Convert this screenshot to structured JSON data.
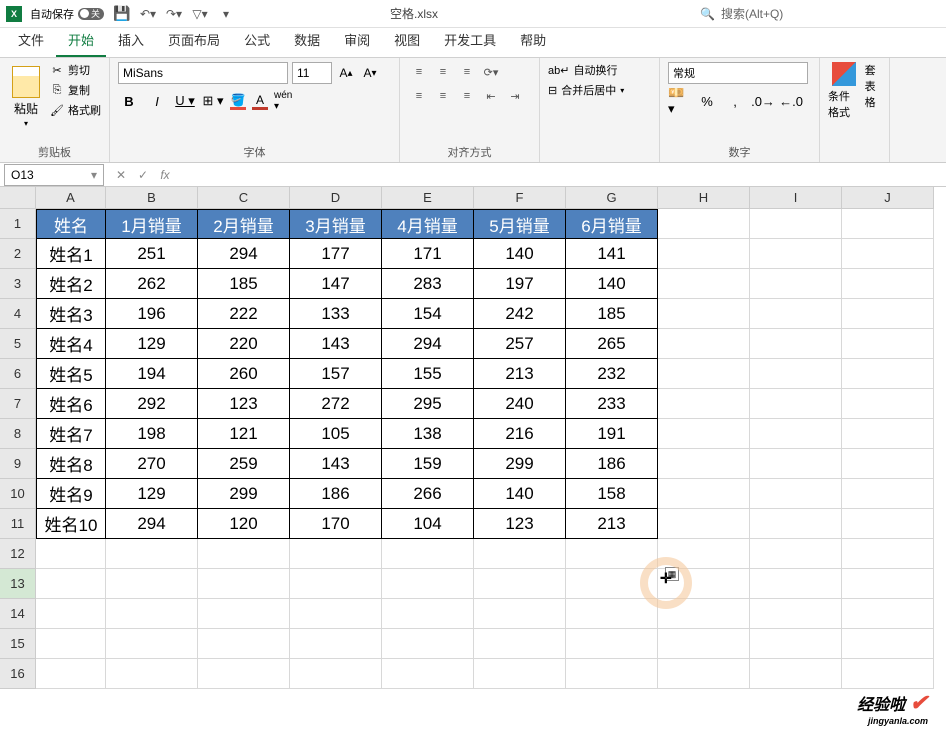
{
  "titlebar": {
    "autosave_label": "自动保存",
    "autosave_state": "关",
    "filename": "空格.xlsx",
    "search_placeholder": "搜索(Alt+Q)"
  },
  "tabs": [
    "文件",
    "开始",
    "插入",
    "页面布局",
    "公式",
    "数据",
    "审阅",
    "视图",
    "开发工具",
    "帮助"
  ],
  "active_tab_index": 1,
  "ribbon": {
    "clipboard": {
      "paste": "粘贴",
      "cut": "剪切",
      "copy": "复制",
      "format_painter": "格式刷",
      "group_label": "剪贴板"
    },
    "font": {
      "font_name": "MiSans",
      "font_size": "11",
      "group_label": "字体"
    },
    "alignment": {
      "group_label": "对齐方式"
    },
    "merge": {
      "wrap": "自动换行",
      "merge_center": "合并后居中"
    },
    "number": {
      "format": "常规",
      "group_label": "数字"
    },
    "styles": {
      "cond_fmt": "条件格式",
      "tbl_fmt": "套\n表格"
    }
  },
  "formula_bar": {
    "cell_ref": "O13"
  },
  "grid": {
    "columns": [
      "A",
      "B",
      "C",
      "D",
      "E",
      "F",
      "G",
      "H",
      "I",
      "J"
    ],
    "headers": [
      "姓名",
      "1月销量",
      "2月销量",
      "3月销量",
      "4月销量",
      "5月销量",
      "6月销量"
    ],
    "rows": [
      {
        "name": "姓名1",
        "vals": [
          251,
          294,
          177,
          171,
          140,
          141
        ]
      },
      {
        "name": "姓名2",
        "vals": [
          262,
          185,
          147,
          283,
          197,
          140
        ]
      },
      {
        "name": "姓名3",
        "vals": [
          196,
          222,
          133,
          154,
          242,
          185
        ]
      },
      {
        "name": "姓名4",
        "vals": [
          129,
          220,
          143,
          294,
          257,
          265
        ]
      },
      {
        "name": "姓名5",
        "vals": [
          194,
          260,
          157,
          155,
          213,
          232
        ]
      },
      {
        "name": "姓名6",
        "vals": [
          292,
          123,
          272,
          295,
          240,
          233
        ]
      },
      {
        "name": "姓名7",
        "vals": [
          198,
          121,
          105,
          138,
          216,
          191
        ]
      },
      {
        "name": "姓名8",
        "vals": [
          270,
          259,
          143,
          159,
          299,
          186
        ]
      },
      {
        "name": "姓名9",
        "vals": [
          129,
          299,
          186,
          266,
          140,
          158
        ]
      },
      {
        "name": "姓名10",
        "vals": [
          294,
          120,
          170,
          104,
          123,
          213
        ]
      }
    ],
    "visible_row_numbers": [
      1,
      2,
      3,
      4,
      5,
      6,
      7,
      8,
      9,
      10,
      11,
      12,
      13,
      14,
      15,
      16
    ],
    "selected_row": 13
  },
  "watermark": {
    "main": "经验啦",
    "sub": "jingyanla.com"
  }
}
